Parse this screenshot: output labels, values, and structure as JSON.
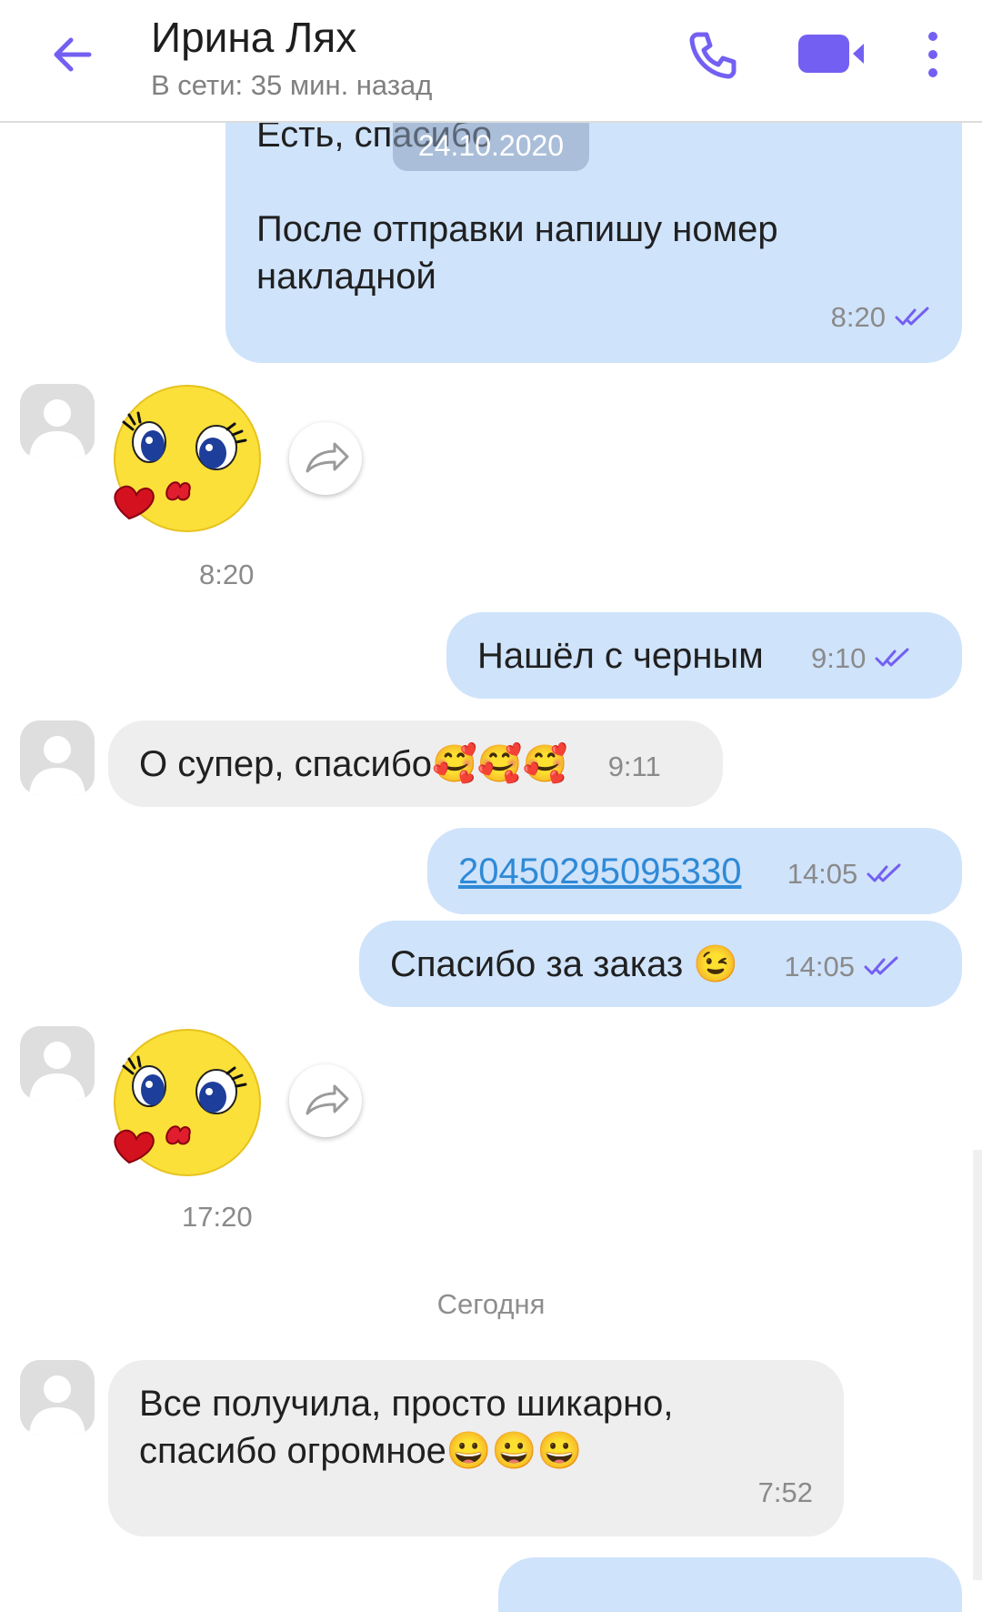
{
  "header": {
    "contact_name": "Ирина Лях",
    "status": "В сети: 35 мин. назад",
    "icons": [
      "back-arrow-icon",
      "phone-icon",
      "video-call-icon",
      "more-vert-icon"
    ],
    "accent_color": "#7360f2"
  },
  "date_pill": "24.10.2020",
  "messages": [
    {
      "direction": "outgoing",
      "text_line1": "Есть, спасибо",
      "text_line2": "После отправки напишу номер",
      "text_line3": "накладной",
      "time": "8:20",
      "status": "read"
    },
    {
      "direction": "incoming",
      "type": "sticker",
      "sticker": "kissing-face-sticker",
      "time": "8:20"
    },
    {
      "direction": "outgoing",
      "text": "Нашёл с черным",
      "time": "9:10",
      "status": "read"
    },
    {
      "direction": "incoming",
      "text": "О супер, спасибо🥰🥰🥰",
      "time": "9:11"
    },
    {
      "direction": "outgoing",
      "text": "20450295095330",
      "time": "14:05",
      "status": "read",
      "is_link": true
    },
    {
      "direction": "outgoing",
      "text": "Спасибо за заказ 😉",
      "time": "14:05",
      "status": "read"
    },
    {
      "direction": "incoming",
      "type": "sticker",
      "sticker": "kissing-face-sticker",
      "time": "17:20"
    },
    {
      "direction": "incoming",
      "text_line1": "Все получила, просто шикарно,",
      "text_line2": "спасибо огромное😀😀😀",
      "time": "7:52"
    }
  ],
  "day_divider": "Сегодня",
  "colors": {
    "outgoing_bubble": "#cfe3fb",
    "incoming_bubble": "#eeeeee",
    "read_ticks": "#7360f2",
    "link": "#2f8ad6"
  }
}
